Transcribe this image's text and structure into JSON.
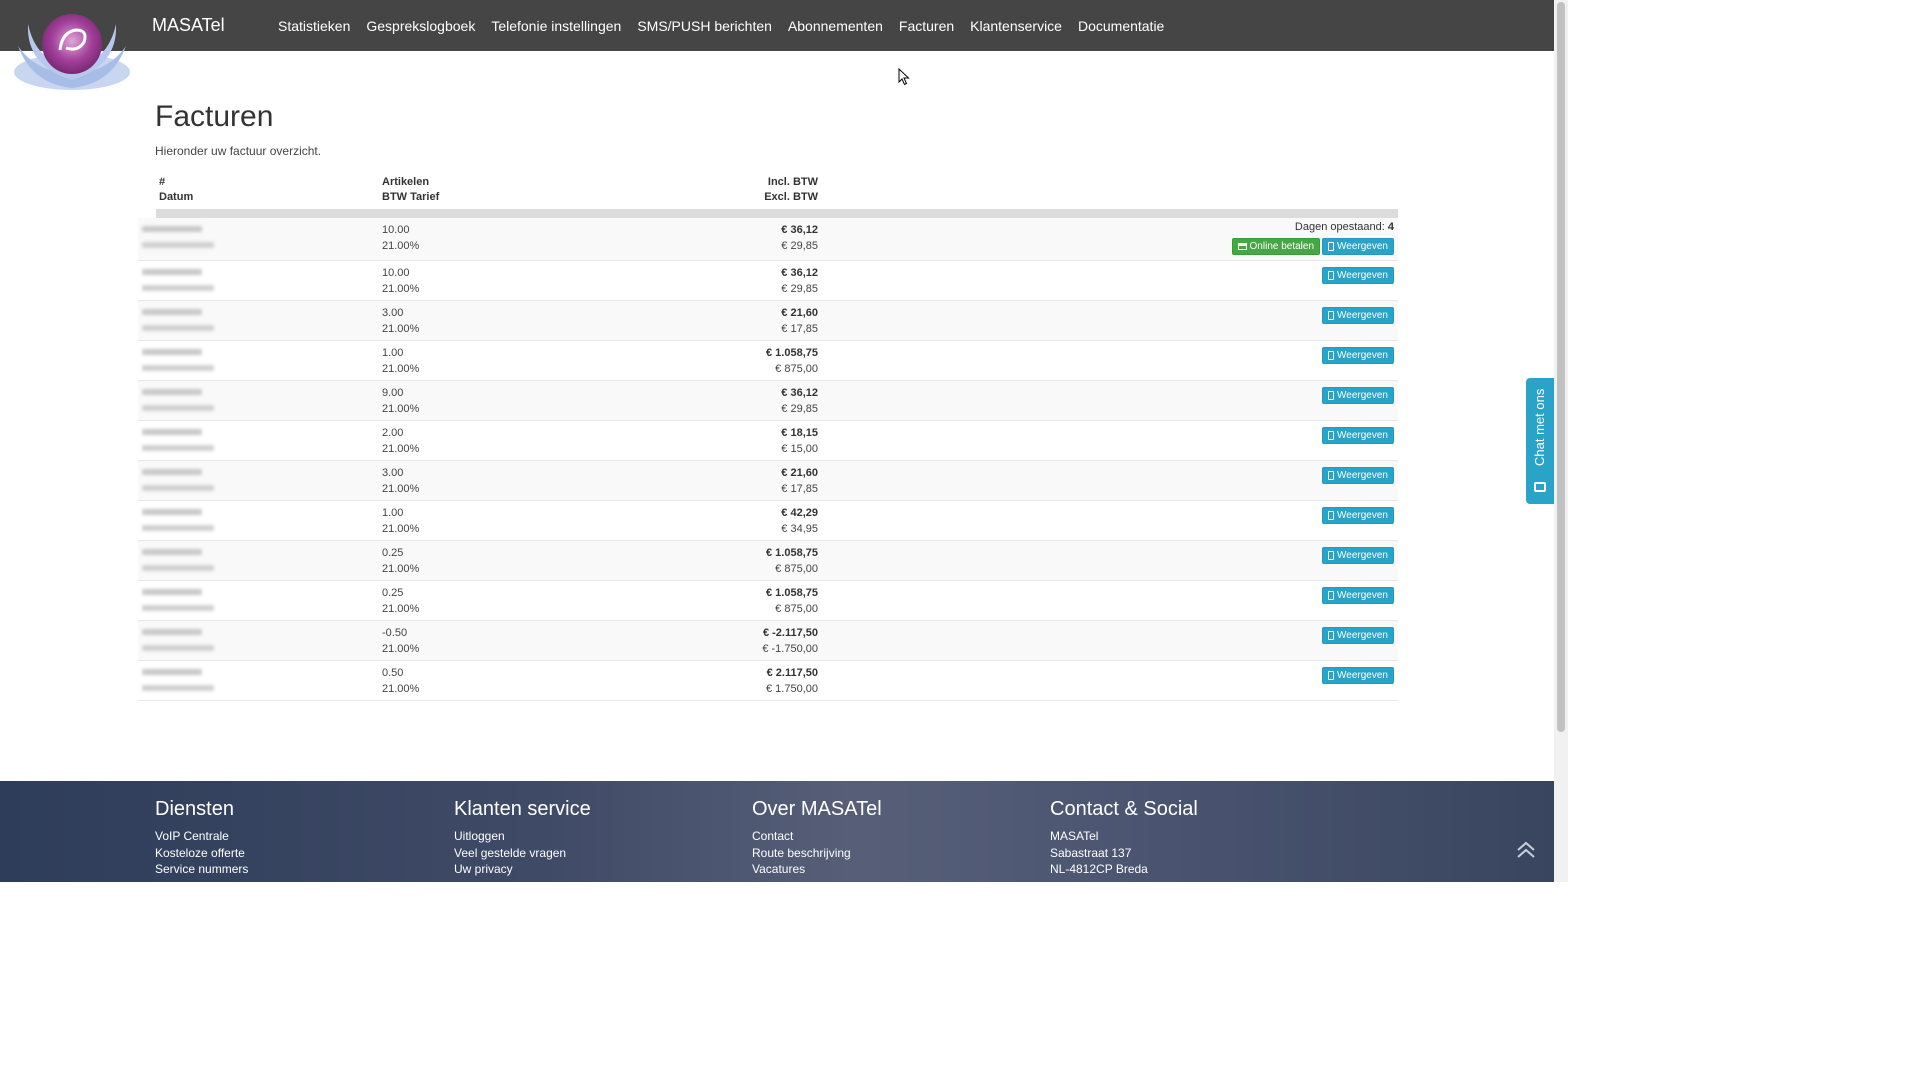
{
  "brand": "MASATel",
  "nav": [
    "Statistieken",
    "Gesprekslogboek",
    "Telefonie instellingen",
    "SMS/PUSH berichten",
    "Abonnementen",
    "Facturen",
    "Klantenservice",
    "Documentatie"
  ],
  "page": {
    "title": "Facturen",
    "subtitle": "Hieronder uw factuur overzicht."
  },
  "table": {
    "headers": {
      "num": "#",
      "date": "Datum",
      "articles": "Artikelen",
      "vat_rate": "BTW Tarief",
      "incl": "Incl. BTW",
      "excl": "Excl. BTW"
    },
    "days_label": "Dagen opestaand:",
    "days_value": "4",
    "pay_label": "Online betalen",
    "view_label": "Weergeven",
    "rows": [
      {
        "articles": "10.00",
        "vat": "21.00%",
        "incl": "€ 36,12",
        "excl": "€ 29,85"
      },
      {
        "articles": "10.00",
        "vat": "21.00%",
        "incl": "€ 36,12",
        "excl": "€ 29,85"
      },
      {
        "articles": "3.00",
        "vat": "21.00%",
        "incl": "€ 21,60",
        "excl": "€ 17,85"
      },
      {
        "articles": "1.00",
        "vat": "21.00%",
        "incl": "€ 1.058,75",
        "excl": "€ 875,00"
      },
      {
        "articles": "9.00",
        "vat": "21.00%",
        "incl": "€ 36,12",
        "excl": "€ 29,85"
      },
      {
        "articles": "2.00",
        "vat": "21.00%",
        "incl": "€ 18,15",
        "excl": "€ 15,00"
      },
      {
        "articles": "3.00",
        "vat": "21.00%",
        "incl": "€ 21,60",
        "excl": "€ 17,85"
      },
      {
        "articles": "1.00",
        "vat": "21.00%",
        "incl": "€ 42,29",
        "excl": "€ 34,95"
      },
      {
        "articles": "0.25",
        "vat": "21.00%",
        "incl": "€ 1.058,75",
        "excl": "€ 875,00"
      },
      {
        "articles": "0.25",
        "vat": "21.00%",
        "incl": "€ 1.058,75",
        "excl": "€ 875,00"
      },
      {
        "articles": "-0.50",
        "vat": "21.00%",
        "incl": "€ -2.117,50",
        "excl": "€ -1.750,00"
      },
      {
        "articles": "0.50",
        "vat": "21.00%",
        "incl": "€ 2.117,50",
        "excl": "€ 1.750,00"
      }
    ]
  },
  "chat": {
    "label": "Chat met ons"
  },
  "footer": {
    "columns": [
      {
        "title": "Diensten",
        "links": [
          "VoIP Centrale",
          "Kosteloze offerte",
          "Service nummers"
        ]
      },
      {
        "title": "Klanten service",
        "links": [
          "Uitloggen",
          "Veel gestelde vragen",
          "Uw privacy"
        ]
      },
      {
        "title": "Over MASATel",
        "links": [
          "Contact",
          "Route beschrijving",
          "Vacatures"
        ]
      },
      {
        "title": "Contact & Social",
        "links": [
          "MASATel",
          "Sabastraat 137",
          "NL-4812CP Breda"
        ]
      }
    ]
  },
  "colors": {
    "navbar": "#454545",
    "info": "#2aa3c9",
    "success": "#45a845"
  },
  "icons": [
    "logo-lotus",
    "card-icon",
    "document-icon",
    "chat-icon",
    "chevron-up-icon",
    "mouse-cursor"
  ]
}
